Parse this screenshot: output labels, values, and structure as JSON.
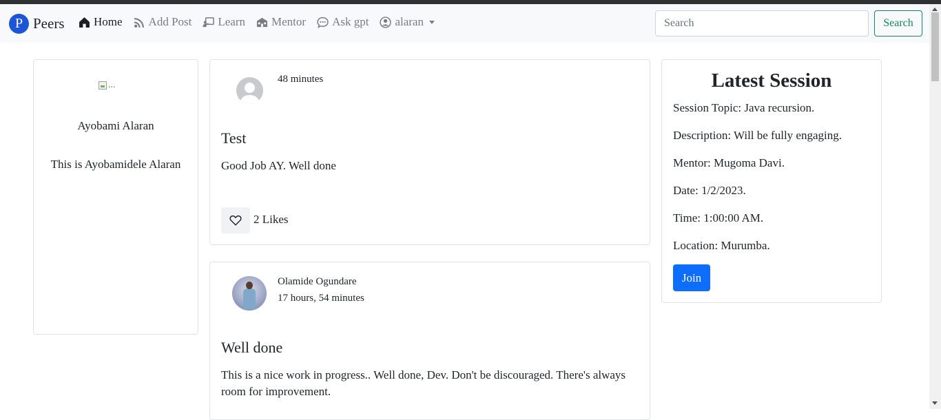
{
  "brand": {
    "logo_letter": "P",
    "name": "Peers"
  },
  "nav": {
    "home": "Home",
    "add_post": "Add Post",
    "learn": "Learn",
    "mentor": "Mentor",
    "ask_gpt": "Ask gpt",
    "user": "alaran"
  },
  "search": {
    "placeholder": "Search",
    "button": "Search"
  },
  "profile": {
    "image_alt": "...",
    "name": "Ayobami Alaran",
    "bio": "This is Ayobamidele Alaran"
  },
  "posts": [
    {
      "author": "",
      "time": "48 minutes",
      "title": "Test",
      "body": "Good Job AY. Well done",
      "likes": "2 Likes"
    },
    {
      "author": "Olamide Ogundare",
      "time": "17 hours, 54 minutes",
      "title": "Well done",
      "body": "This is a nice work in progress.. Well done, Dev. Don't be discouraged. There's always room for improvement."
    }
  ],
  "session": {
    "heading": "Latest Session",
    "topic": "Session Topic: Java recursion.",
    "description": "Description: Will be fully engaging.",
    "mentor": "Mentor: Mugoma Davi.",
    "date": "Date: 1/2/2023.",
    "time": "Time: 1:00:00 AM.",
    "location": "Location: Murumba.",
    "join": "Join"
  },
  "colors": {
    "brand_logo": "#1c55d6",
    "search_button": "#198754",
    "join_button": "#0d6efd",
    "navbar_bg": "#f8f9fa"
  },
  "icons": {
    "home": "house-icon",
    "add_post": "rss-icon",
    "learn": "chalkboard-icon",
    "mentor": "building-icon",
    "ask_gpt": "chat-bubble-icon",
    "user": "user-circle-icon",
    "like": "heart-icon"
  }
}
